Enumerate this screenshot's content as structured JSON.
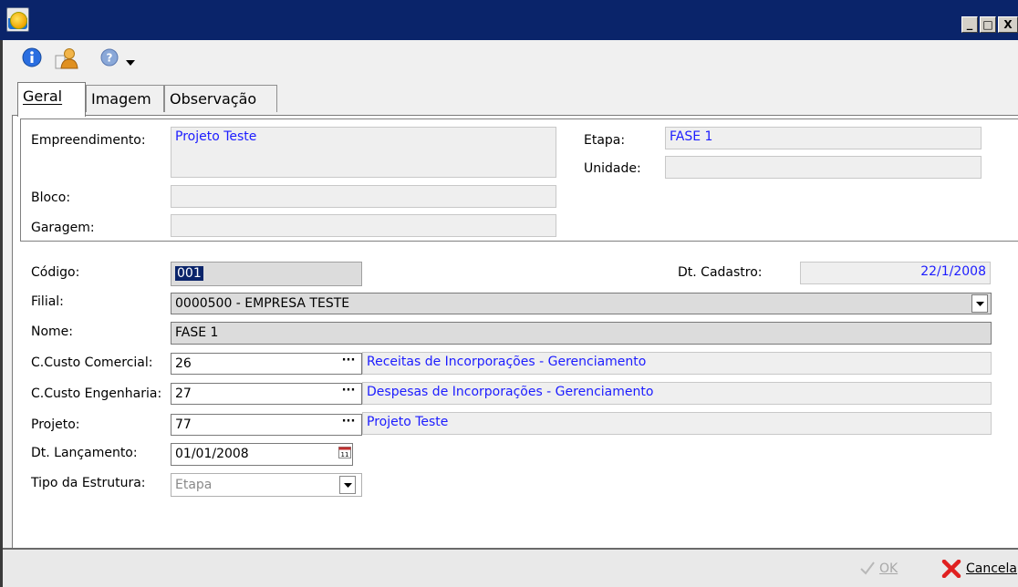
{
  "window": {
    "controls": {
      "minimize": "_",
      "maximize": "□",
      "close": "X"
    }
  },
  "toolbar": {
    "icons": [
      "info-icon",
      "user-icon",
      "help-icon",
      "dropdown-arrow-icon"
    ]
  },
  "tabs": [
    {
      "label": "Geral",
      "active": true
    },
    {
      "label": "Imagem",
      "active": false
    },
    {
      "label": "Observação",
      "active": false
    }
  ],
  "group": {
    "empreendimento_label": "Empreendimento:",
    "empreendimento_value": "Projeto Teste",
    "etapa_label": "Etapa:",
    "etapa_value": "FASE 1",
    "unidade_label": "Unidade:",
    "unidade_value": "",
    "bloco_label": "Bloco:",
    "bloco_value": "",
    "garagem_label": "Garagem:",
    "garagem_value": ""
  },
  "form": {
    "codigo_label": "Código:",
    "codigo_value": "001",
    "dt_cadastro_label": "Dt. Cadastro:",
    "dt_cadastro_value": "22/1/2008",
    "filial_label": "Filial:",
    "filial_value": "0000500 - EMPRESA TESTE",
    "nome_label": "Nome:",
    "nome_value": "FASE 1",
    "ccusto_comercial_label": "C.Custo Comercial:",
    "ccusto_comercial_value": "26",
    "ccusto_comercial_desc": "Receitas de Incorporações - Gerenciamento",
    "ccusto_engenharia_label": "C.Custo Engenharia:",
    "ccusto_engenharia_value": "27",
    "ccusto_engenharia_desc": "Despesas de Incorporações - Gerenciamento",
    "projeto_label": "Projeto:",
    "projeto_value": "77",
    "projeto_desc": "Projeto Teste",
    "dt_lancamento_label": "Dt. Lançamento:",
    "dt_lancamento_value": "01/01/2008",
    "tipo_estrutura_label": "Tipo da Estrutura:",
    "tipo_estrutura_value": "Etapa",
    "ellipsis": "···"
  },
  "buttons": {
    "ok_label": "OK",
    "cancel_label": "Cancela"
  },
  "colors": {
    "titlebar": "#0a246a",
    "readonly_text": "#1c1cff"
  }
}
